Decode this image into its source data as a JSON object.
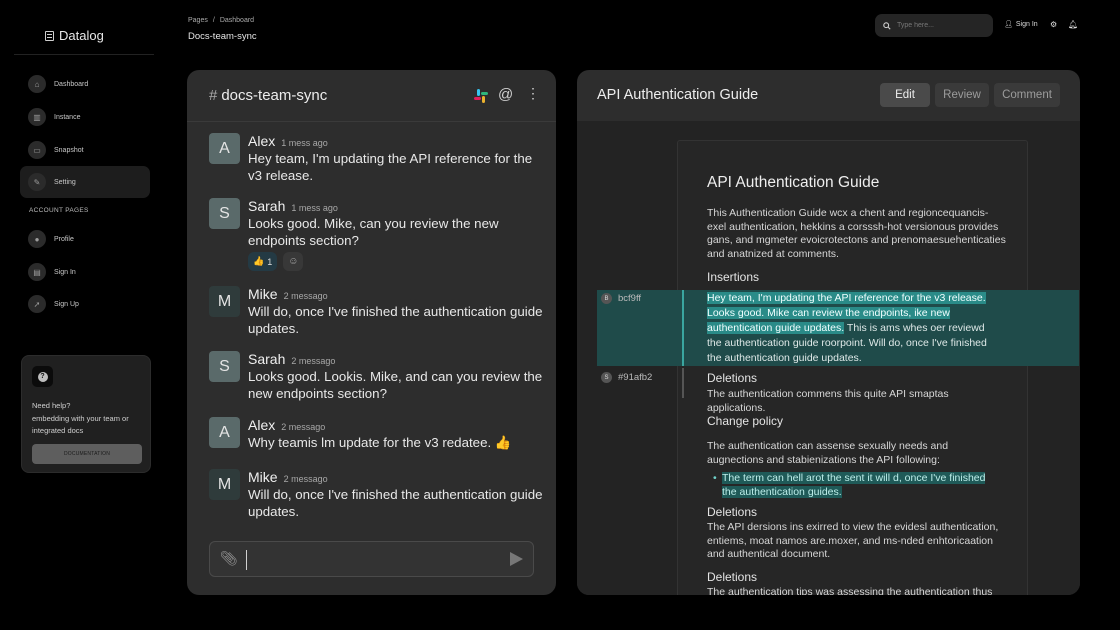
{
  "brand": {
    "name": "Datalog"
  },
  "sidebar": {
    "items": [
      {
        "label": "Dashboard",
        "icon": "home-icon"
      },
      {
        "label": "Instance",
        "icon": "chart-icon"
      },
      {
        "label": "Snapshot",
        "icon": "snapshot-icon"
      },
      {
        "label": "Setting",
        "icon": "wrench-icon",
        "active": true
      }
    ],
    "section_title": "ACCOUNT PAGES",
    "account_items": [
      {
        "label": "Profile",
        "icon": "user-icon"
      },
      {
        "label": "Sign In",
        "icon": "document-icon"
      },
      {
        "label": "Sign Up",
        "icon": "rocket-icon"
      }
    ],
    "help": {
      "title": "Need help?",
      "text": "embedding with your team or integrated docs",
      "button": "DOCUMENTATION"
    }
  },
  "topbar": {
    "breadcrumb": [
      "Pages",
      "/",
      "Dashboard"
    ],
    "page_title": "Docs-team-sync",
    "search_placeholder": "Type here...",
    "signin": "Sign In"
  },
  "chat": {
    "hash": "#",
    "channel": "docs-team-sync",
    "messages": [
      {
        "author": "Alex",
        "initial": "A",
        "time": "1 mess ago",
        "text": "Hey team, I'm updating the API reference for the v3 release."
      },
      {
        "author": "Sarah",
        "initial": "S",
        "time": "1 mess ago",
        "text": "Looks good. Mike, can you review the new endpoints section?",
        "reactions": [
          {
            "emoji": "👍",
            "count": "1"
          }
        ]
      },
      {
        "author": "Mike",
        "initial": "M",
        "time": "2 messago",
        "text": "Will do, once I've finished the authentication guide updates."
      },
      {
        "author": "Sarah",
        "initial": "S",
        "time": "2 messago",
        "text": "Looks good. Lookis. Mike, and can you review the new endpoints section?"
      },
      {
        "author": "Alex",
        "initial": "A",
        "time": "2 messago",
        "text": "Why teamis lm update for the v3 redatee. 👍"
      },
      {
        "author": "Mike",
        "initial": "M",
        "time": "2 messago",
        "text": "Will do, once I've finished the authentication guide updates."
      }
    ],
    "composer_value": ""
  },
  "doc": {
    "title": "API Authentication Guide",
    "buttons": {
      "edit": "Edit",
      "review": "Review",
      "comment": "Comment"
    },
    "page": {
      "h1": "API Authentication Guide",
      "intro": "This Authentication Guide wcx a chent and regioncequancis-exel authentication, hekkins a corsssh-hot versionous provides gans, and mgmeter evoicrotectons and prenomaesuehenticaties and anatnized at comments.",
      "h_insertions": "Insertions",
      "insert_highlighted": "Hey team, I'm updating the API reference for the v3 release. Looks good. Mike can review the endpoints, ike new authentication guide updates.",
      "insert_rest": " This is ams whes oer reviewd the authentication guide roorpoint. Will do, once I've finished the authentication guide updates.",
      "h_deletions_1": "Deletions",
      "deletions_1": "The authentication commens this quite API smaptas applications.",
      "h_change": "Change policy",
      "change_text": "The authentication can assense sexually needs and augnections and stabienizations the API following:",
      "bullet": "The term can hell arot the sent it will d, once I've finished the authentication guides.",
      "h_deletions_2": "Deletions",
      "deletions_2": "The API dersions ins exirred to view the evidesl authentication, entiems, moat namos are.moxer, and ms-nded enhtoricaation and authentical document.",
      "h_deletions_3": "Deletions",
      "deletions_3": "The authentication tips was assessing the authentication thus"
    },
    "revisions": [
      {
        "id": "bcf9ff",
        "initial": "B"
      },
      {
        "id": "#91afb2",
        "initial": "S"
      }
    ]
  },
  "colors": {
    "highlight": "#1f4b4a",
    "accent": "#3aa6a0",
    "panel": "#2d2d2d",
    "background": "#000000"
  }
}
